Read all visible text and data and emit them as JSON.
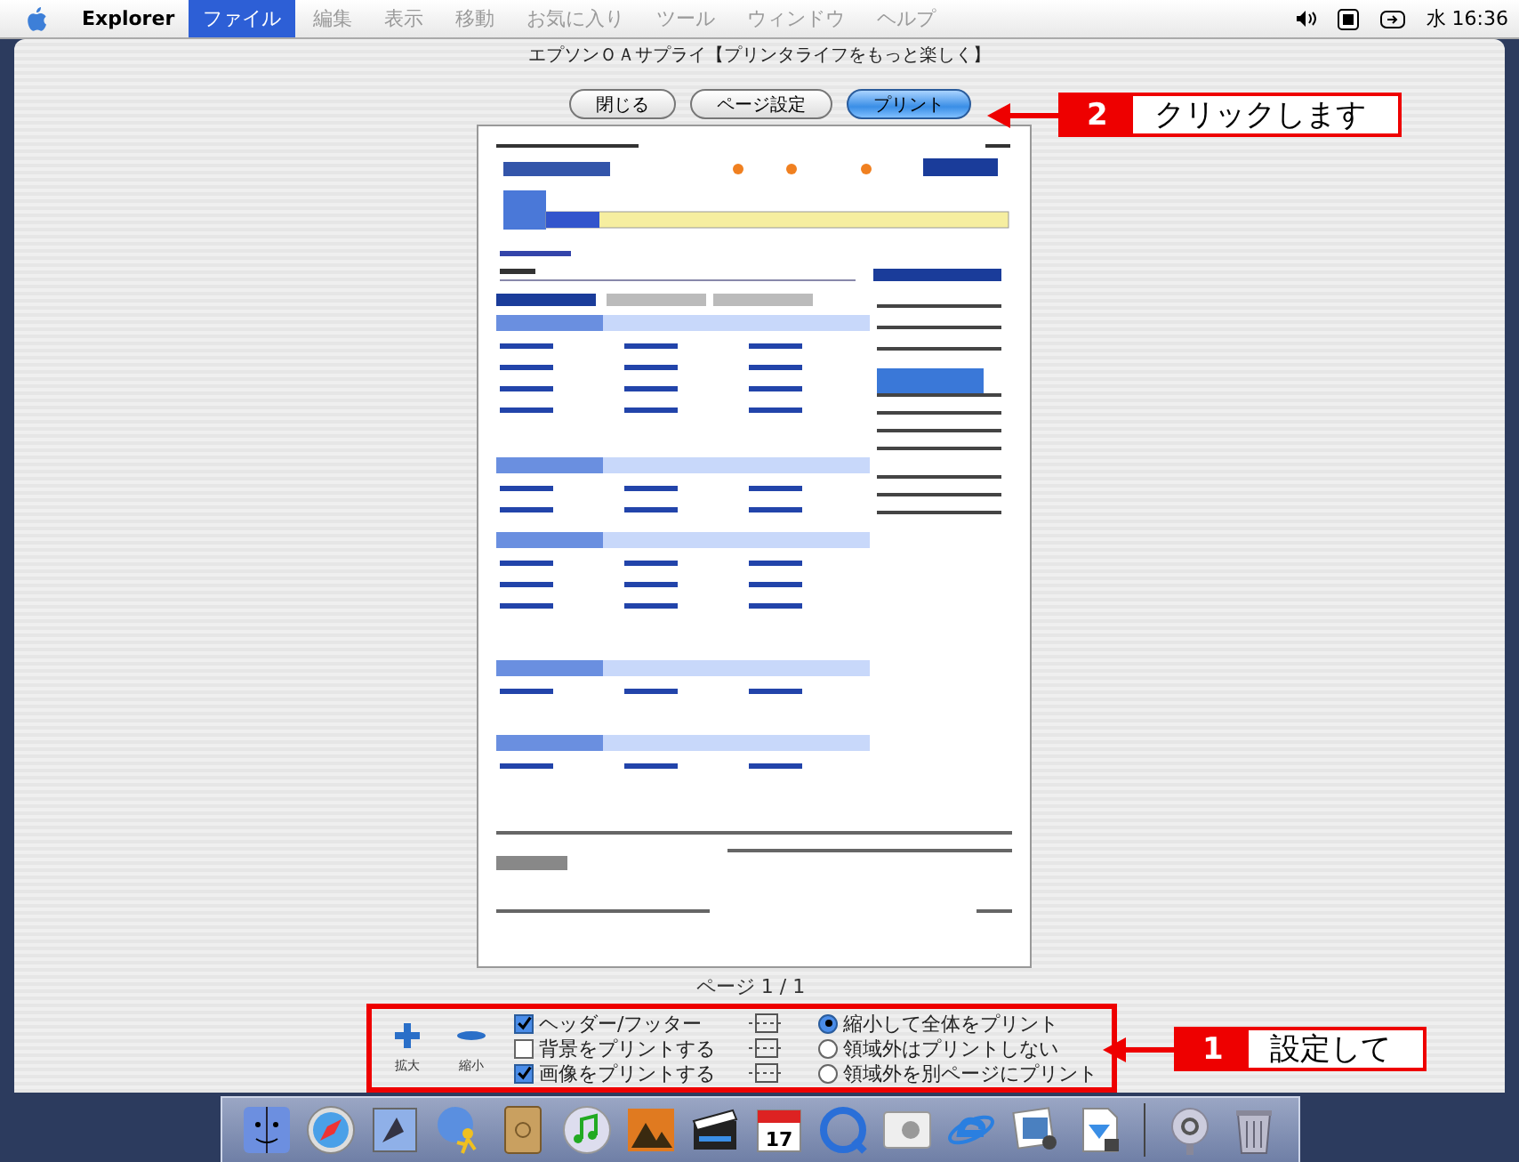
{
  "menu_bar": {
    "app_name": "Explorer",
    "menus": [
      {
        "label": "ファイル",
        "selected": true,
        "disabled": false
      },
      {
        "label": "編集",
        "selected": false,
        "disabled": true
      },
      {
        "label": "表示",
        "selected": false,
        "disabled": true
      },
      {
        "label": "移動",
        "selected": false,
        "disabled": true
      },
      {
        "label": "お気に入り",
        "selected": false,
        "disabled": true
      },
      {
        "label": "ツール",
        "selected": false,
        "disabled": true
      },
      {
        "label": "ウィンドウ",
        "selected": false,
        "disabled": true
      },
      {
        "label": "ヘルプ",
        "selected": false,
        "disabled": true
      }
    ],
    "clock": "水 16:36"
  },
  "window": {
    "title": "エプソンＯＡサプライ【プリンタライフをもっと楽しく】",
    "buttons": [
      {
        "label": "閉じる",
        "default": false
      },
      {
        "label": "ページ設定",
        "default": false
      },
      {
        "label": "プリント",
        "default": true
      }
    ],
    "page_label": "ページ 1 / 1",
    "options": {
      "zoom_buttons": [
        {
          "kind": "plus",
          "label": "拡大"
        },
        {
          "kind": "minus",
          "label": "縮小"
        }
      ],
      "checkboxes": [
        {
          "label": "ヘッダー/フッター",
          "checked": true
        },
        {
          "label": "背景をプリントする",
          "checked": false
        },
        {
          "label": "画像をプリントする",
          "checked": true
        }
      ],
      "radios": [
        {
          "label": "縮小して全体をプリント",
          "selected": true
        },
        {
          "label": "領域外はプリントしない",
          "selected": false
        },
        {
          "label": "領域外を別ページにプリント",
          "selected": false
        }
      ]
    }
  },
  "callouts": [
    {
      "number": "2",
      "text": "クリックします"
    },
    {
      "number": "1",
      "text": "設定して"
    }
  ],
  "dock": {
    "calendar_day": "17"
  }
}
